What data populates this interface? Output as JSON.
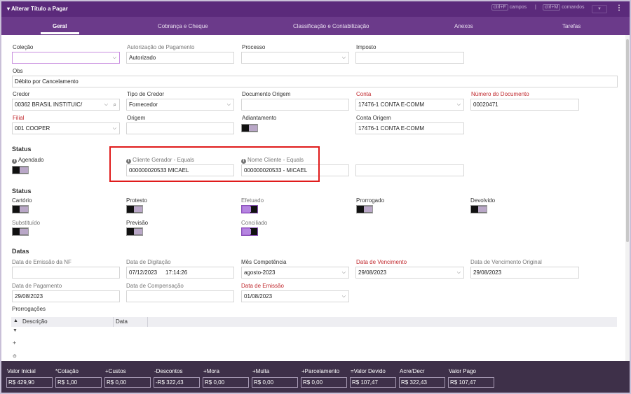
{
  "window": {
    "title": "▾ Alterar Título a Pagar",
    "hint_key1": "ctrl+F",
    "hint_text1": "campos",
    "hint_sep": "|",
    "hint_key2": "ctrl+M",
    "hint_text2": "comandos",
    "more": "⋮"
  },
  "tabs": [
    "Geral",
    "Cobrança e Cheque",
    "Classificação e Contabilização",
    "Anexos",
    "Tarefas"
  ],
  "fields": {
    "colecao": {
      "label": "Coleção",
      "value": ""
    },
    "autorizacao": {
      "label": "Autorização de Pagamento",
      "value": "Autorizado"
    },
    "processo": {
      "label": "Processo",
      "value": ""
    },
    "imposto": {
      "label": "Imposto",
      "value": ""
    },
    "obs": {
      "label": "Obs",
      "value": "Débito por Cancelamento"
    },
    "credor": {
      "label": "Credor",
      "value": "00362 BRASIL INSTITUIC/"
    },
    "tipo_credor": {
      "label": "Tipo de Credor",
      "value": "Fornecedor"
    },
    "documento_origem": {
      "label": "Documento Origem",
      "value": ""
    },
    "conta": {
      "label": "Conta",
      "value": "17476-1 CONTA E-COMM"
    },
    "numero_documento": {
      "label": "Número do Documento",
      "value": "00020471"
    },
    "filial": {
      "label": "Filial",
      "value": "001 COOPER"
    },
    "origem": {
      "label": "Origem",
      "value": ""
    },
    "adiantamento": {
      "label": "Adiantamento"
    },
    "conta_origem": {
      "label": "Conta Origem",
      "value": "17476-1 CONTA E-COMM"
    }
  },
  "status1": {
    "title": "Status",
    "agendado": "Agendado",
    "cliente_gerador": {
      "label": "Cliente Gerador - Equals",
      "value": "000000020533 MICAEL"
    },
    "nome_cliente": {
      "label": "Nome Cliente - Equals",
      "value": "000000020533 - MICAEL"
    }
  },
  "status2": {
    "title": "Status",
    "cartorio": "Cartório",
    "protesto": "Protesto",
    "efetuado": "Efetuado",
    "prorrogado": "Prorrogado",
    "devolvido": "Devolvido",
    "substituido": "Substituído",
    "previsao": "Previsão",
    "conciliado": "Conciliado"
  },
  "datas": {
    "title": "Datas",
    "emissao_nf": {
      "label": "Data de Emissão da NF",
      "value": ""
    },
    "digitacao": {
      "label": "Data de Digitação",
      "date": "07/12/2023",
      "time": "17:14:26"
    },
    "mes_competencia": {
      "label": "Mês Competência",
      "value": "agosto-2023"
    },
    "vencimento": {
      "label": "Data de Vencimento",
      "value": "29/08/2023"
    },
    "vencimento_original": {
      "label": "Data de Vencimento Original",
      "value": "29/08/2023"
    },
    "pagamento": {
      "label": "Data de Pagamento",
      "value": "29/08/2023"
    },
    "compensacao": {
      "label": "Data de Compensação",
      "value": ""
    },
    "emissao": {
      "label": "Data de Emissão",
      "value": "01/08/2023"
    }
  },
  "prorrogacoes": {
    "title": "Prorrogações",
    "col_descricao": "Descrição",
    "col_data": "Data"
  },
  "totals": [
    {
      "label": "Valor Inicial",
      "value": "R$ 429,90"
    },
    {
      "label": "*Cotação",
      "value": "R$ 1,00"
    },
    {
      "label": "+Custos",
      "value": "R$ 0,00"
    },
    {
      "label": "-Descontos",
      "value": "-R$ 322,43"
    },
    {
      "label": "+Mora",
      "value": "R$ 0,00"
    },
    {
      "label": "+Multa",
      "value": "R$ 0,00"
    },
    {
      "label": "+Parcelamento",
      "value": "R$ 0,00"
    },
    {
      "label": "=Valor Devido",
      "value": "R$ 107,47"
    },
    {
      "label": "Acre/Decr",
      "value": "R$ 322,43"
    },
    {
      "label": "Valor Pago",
      "value": "R$ 107,47"
    }
  ],
  "colors": {
    "header": "#5b2a7b",
    "tabbar": "#6b3a8a",
    "footer": "#3e3049",
    "required": "#c0282d",
    "highlight": "#e01b1b"
  }
}
